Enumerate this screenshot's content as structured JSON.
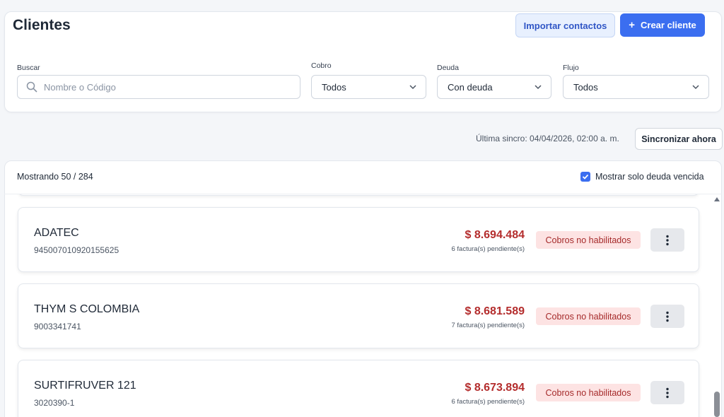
{
  "header": {
    "title": "Clientes",
    "import_label": "Importar contactos",
    "create_label": "Crear cliente",
    "create_icon": "+"
  },
  "filters": {
    "search": {
      "label": "Buscar",
      "placeholder": "Nombre o Código",
      "value": ""
    },
    "cobro": {
      "label": "Cobro",
      "value": "Todos"
    },
    "deuda": {
      "label": "Deuda",
      "value": "Con deuda"
    },
    "flujo": {
      "label": "Flujo",
      "value": "Todos"
    }
  },
  "sync": {
    "text": "Última sincro: 04/04/2026, 02:00 a. m.",
    "button_label": "Sincronizar ahora"
  },
  "list": {
    "showing": "Mostrando 50 / 284",
    "overdue_label": "Mostrar solo deuda vencida",
    "overdue_checked": true,
    "clients": [
      {
        "name": "ADATEC",
        "code": "945007010920155625",
        "amount": "$ 8.694.484",
        "invoices": "6 factura(s) pendiente(s)",
        "status": "Cobros no habilitados"
      },
      {
        "name": "THYM S COLOMBIA",
        "code": "9003341741",
        "amount": "$ 8.681.589",
        "invoices": "7 factura(s) pendiente(s)",
        "status": "Cobros no habilitados"
      },
      {
        "name": "SURTIFRUVER 121",
        "code": "3020390-1",
        "amount": "$ 8.673.894",
        "invoices": "6 factura(s) pendiente(s)",
        "status": "Cobros no habilitados"
      }
    ]
  },
  "colors": {
    "primary": "#3b6ef0",
    "debt_red": "#b42d2d",
    "badge_bg": "#fde3e3"
  }
}
